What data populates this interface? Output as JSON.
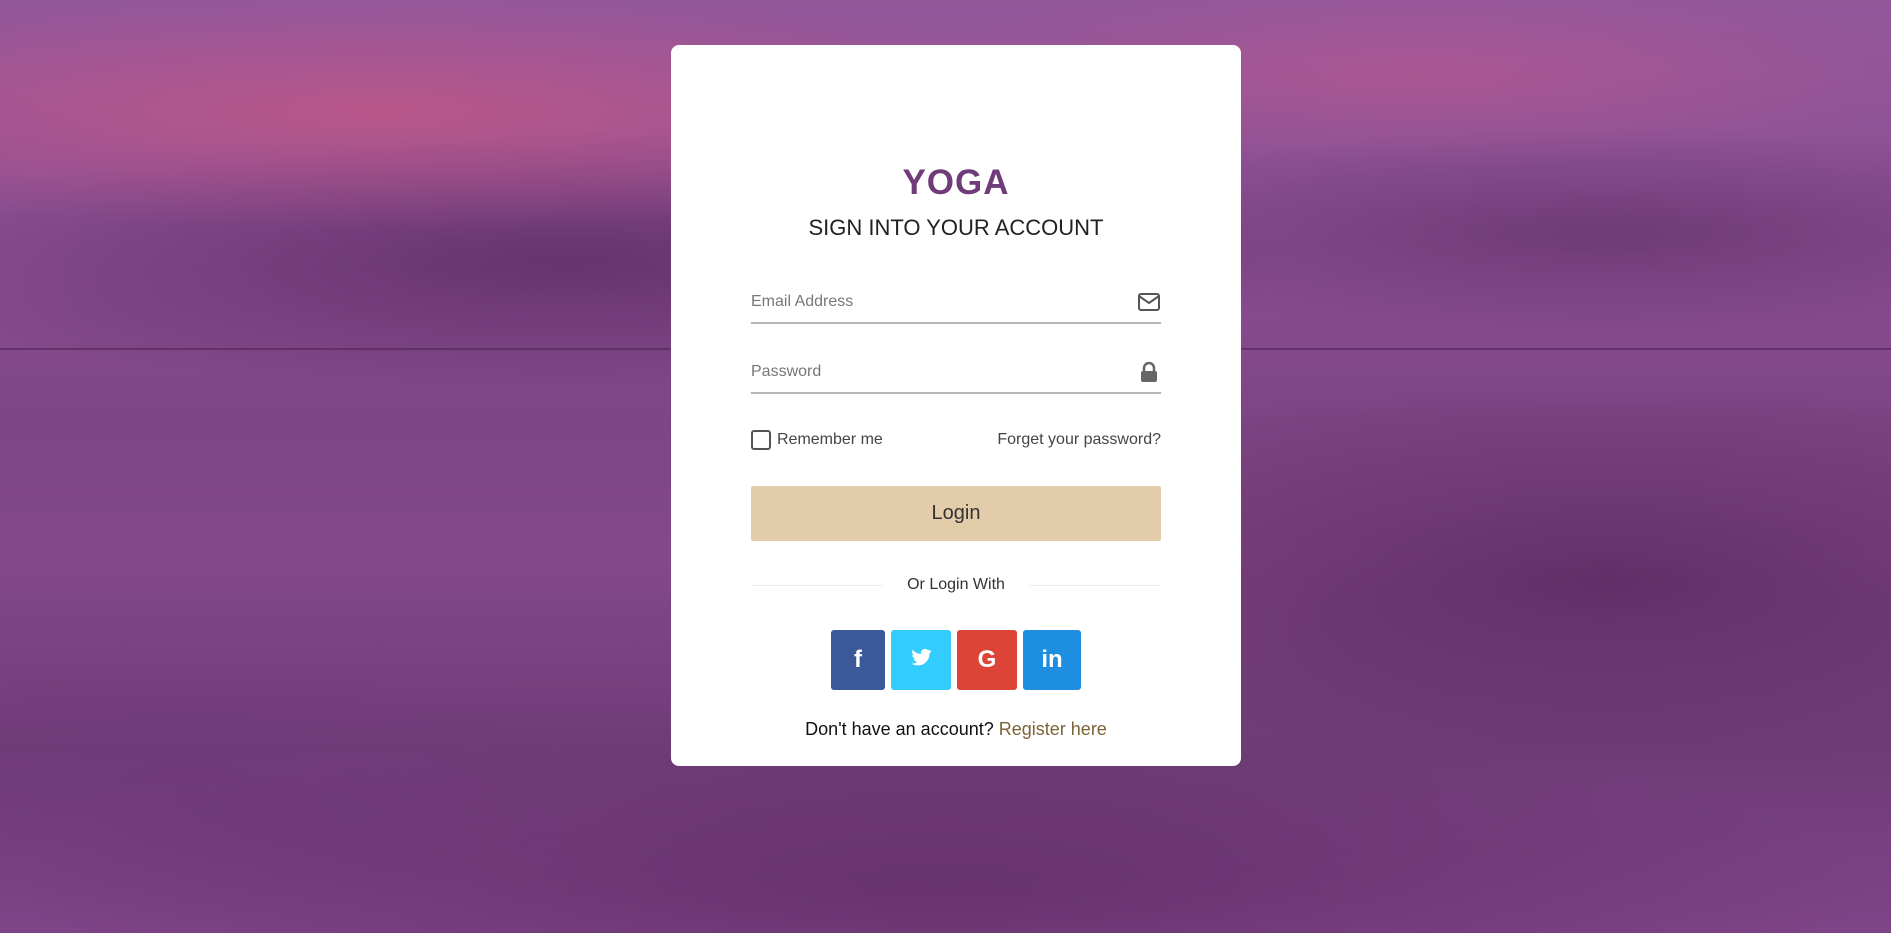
{
  "brand": {
    "logo": "YOGA",
    "subtitle": "SIGN INTO YOUR ACCOUNT"
  },
  "form": {
    "email_placeholder": "Email Address",
    "password_placeholder": "Password",
    "remember_label": "Remember me",
    "remember_checked": false,
    "forgot_label": "Forget your password?",
    "login_label": "Login"
  },
  "social": {
    "divider_label": "Or Login With",
    "buttons": [
      {
        "name": "facebook",
        "glyph": "f",
        "icon": "facebook-icon",
        "color": "#3b5998"
      },
      {
        "name": "twitter",
        "glyph": "",
        "icon": "twitter-icon",
        "color": "#33ccff"
      },
      {
        "name": "google",
        "glyph": "G",
        "icon": "google-icon",
        "color": "#db4437"
      },
      {
        "name": "linkedin",
        "glyph": "in",
        "icon": "linkedin-icon",
        "color": "#1e8ee0"
      }
    ]
  },
  "footer": {
    "prompt": "Don't have an account?",
    "register_label": "Register here"
  },
  "colors": {
    "accent": "#6f3b78",
    "button": "#e2cca9",
    "link": "#7d6336"
  }
}
